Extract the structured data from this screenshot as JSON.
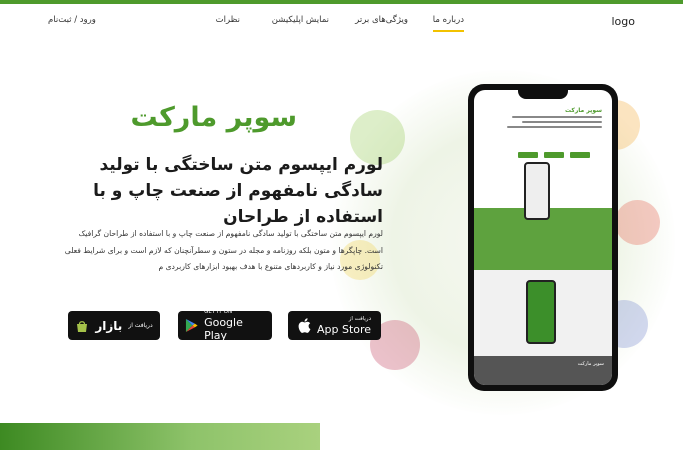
{
  "header": {
    "logo": "logo",
    "nav": [
      {
        "label": "درباره ما",
        "active": true
      },
      {
        "label": "ویژگی‌های برتر",
        "active": false
      },
      {
        "label": "نمایش اپلیکیشن",
        "active": false
      },
      {
        "label": "نظرات",
        "active": false
      }
    ],
    "login": "ورود / ثبت‌نام"
  },
  "hero": {
    "title": "سوپر مارکت",
    "subtitle": "لورم ایپسوم متن ساختگی با تولید سادگی نامفهوم از صنعت چاپ و با استفاده از طراحان",
    "paragraph": "لورم ایپسوم متن ساختگی با تولید سادگی نامفهوم از صنعت چاپ و با استفاده از طراحان گرافیک است. چاپگرها و متون بلکه روزنامه و مجله در ستون و سطرآنچنان که لازم است و برای شرایط فعلی تکنولوژی مورد نیاز و کاربردهای متنوع با هدف بهبود ابزارهای کاربردی م"
  },
  "stores": {
    "appstore": {
      "small": "دریافت از",
      "big": "App Store"
    },
    "googleplay": {
      "small": "GET IT ON",
      "big": "Google Play"
    },
    "bazaar": {
      "small": "دریافت از",
      "big": "بازار"
    }
  },
  "mockup": {
    "title": "سوپر مارکت",
    "footer_title": "سوپر مارکت"
  },
  "colors": {
    "accent": "#4e9a2c",
    "underline": "#f2c200"
  }
}
